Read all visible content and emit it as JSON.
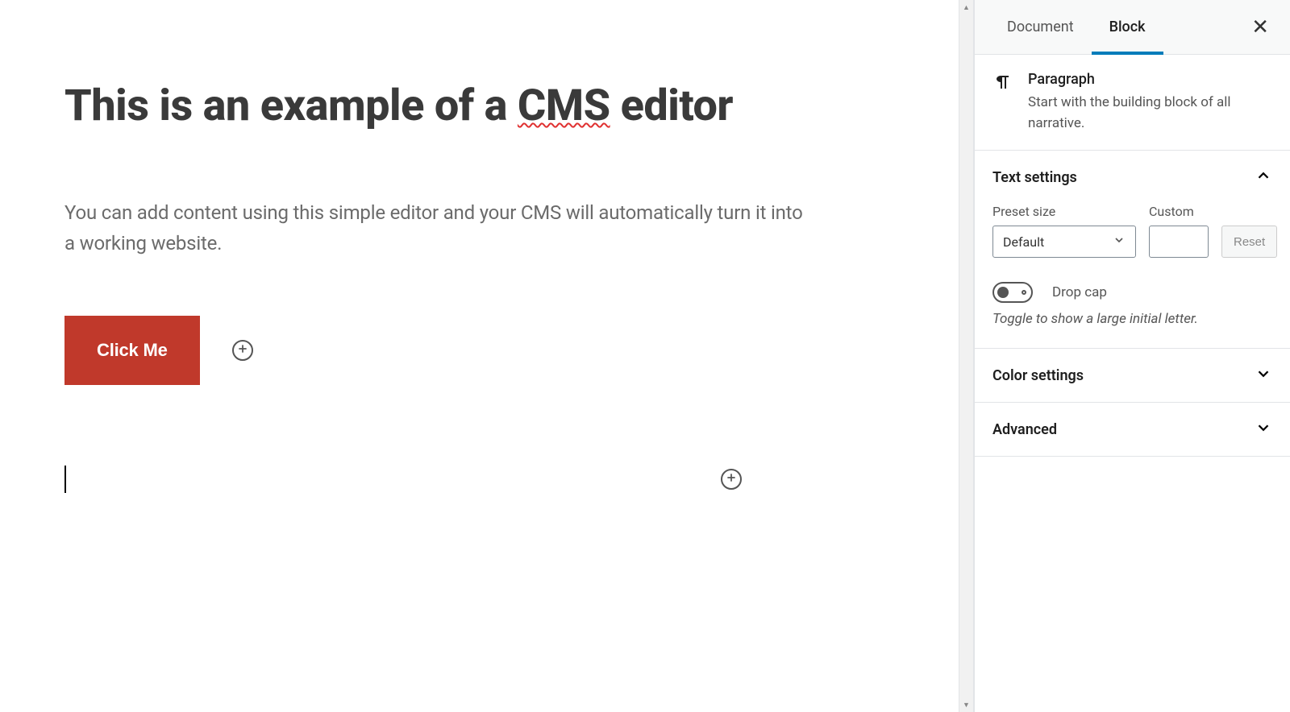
{
  "editor": {
    "title_prefix": "This is an example of a ",
    "title_spellcheck": "CMS",
    "title_suffix": " editor",
    "paragraph": "You can add content using this simple editor and your CMS will automatically turn it into a working website.",
    "button_label": "Click Me"
  },
  "sidebar": {
    "tabs": {
      "document": "Document",
      "block": "Block"
    },
    "block_info": {
      "title": "Paragraph",
      "description": "Start with the building block of all narrative."
    },
    "panels": {
      "text_settings": {
        "title": "Text settings",
        "preset_label": "Preset size",
        "preset_value": "Default",
        "custom_label": "Custom",
        "custom_value": "",
        "reset_label": "Reset",
        "dropcap_label": "Drop cap",
        "dropcap_hint": "Toggle to show a large initial letter."
      },
      "color_settings": {
        "title": "Color settings"
      },
      "advanced": {
        "title": "Advanced"
      }
    }
  }
}
